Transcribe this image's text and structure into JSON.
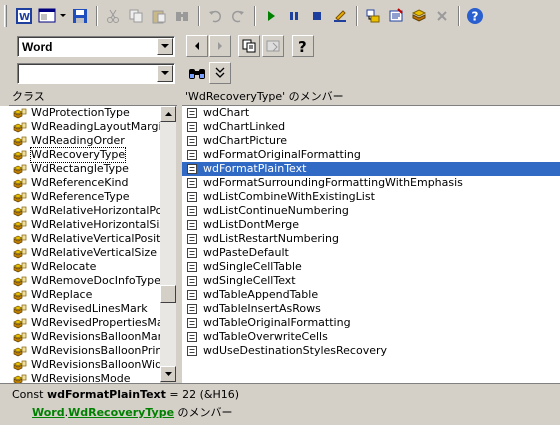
{
  "toolbar": {
    "buttons": [
      "word-app-icon",
      "view-code-icon",
      "save-icon",
      "cut-icon",
      "copy-icon",
      "paste-icon",
      "find-icon",
      "undo-icon",
      "redo-icon",
      "run-icon",
      "break-icon",
      "reset-icon",
      "design-mode-icon",
      "project-explorer-icon",
      "properties-icon",
      "object-browser-icon",
      "toolbox-icon",
      "help-icon"
    ]
  },
  "library_combo": {
    "value": "Word"
  },
  "search_combo": {
    "value": ""
  },
  "classes_panel": {
    "header": "クラス",
    "items": [
      "WdProtectionType",
      "WdReadingLayoutMargin",
      "WdReadingOrder",
      "WdRecoveryType",
      "WdRectangleType",
      "WdReferenceKind",
      "WdReferenceType",
      "WdRelativeHorizontalPos",
      "WdRelativeHorizontalSize",
      "WdRelativeVerticalPositi",
      "WdRelativeVerticalSize",
      "WdRelocate",
      "WdRemoveDocInfoType",
      "WdReplace",
      "WdRevisedLinesMark",
      "WdRevisedPropertiesMar",
      "WdRevisionsBalloonMarg",
      "WdRevisionsBalloonPrint",
      "WdRevisionsBalloonWidtl",
      "WdRevisionsMode"
    ],
    "focused_index": 3
  },
  "members_panel": {
    "header": "'WdRecoveryType' のメンバー",
    "items": [
      "wdChart",
      "wdChartLinked",
      "wdChartPicture",
      "wdFormatOriginalFormatting",
      "wdFormatPlainText",
      "wdFormatSurroundingFormattingWithEmphasis",
      "wdListCombineWithExistingList",
      "wdListContinueNumbering",
      "wdListDontMerge",
      "wdListRestartNumbering",
      "wdPasteDefault",
      "wdSingleCellTable",
      "wdSingleCellText",
      "wdTableAppendTable",
      "wdTableInsertAsRows",
      "wdTableOriginalFormatting",
      "wdTableOverwriteCells",
      "wdUseDestinationStylesRecovery"
    ],
    "selected_index": 4
  },
  "scrollbar": {
    "position_fraction": 0.72
  },
  "details": {
    "prefix": "Const ",
    "member_name": "wdFormatPlainText",
    "value_text": " = 22 (&H16)",
    "library_link": "Word",
    "dot": ".",
    "class_link": "WdRecoveryType",
    "suffix": " のメンバー"
  },
  "colors": {
    "selection": "#316ac5",
    "link": "#008000",
    "face": "#d4d0c8"
  }
}
